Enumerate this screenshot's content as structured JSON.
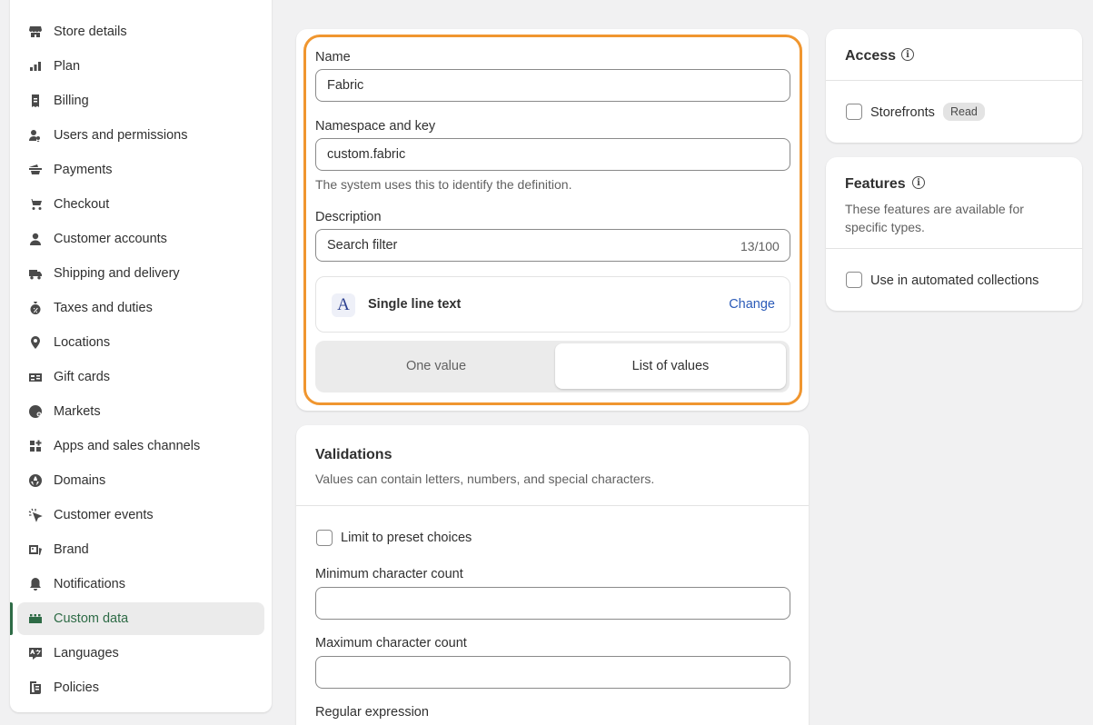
{
  "sidebar": {
    "items": [
      {
        "label": "Store details",
        "icon": "store-icon"
      },
      {
        "label": "Plan",
        "icon": "plan-icon"
      },
      {
        "label": "Billing",
        "icon": "billing-icon"
      },
      {
        "label": "Users and permissions",
        "icon": "users-icon"
      },
      {
        "label": "Payments",
        "icon": "payments-icon"
      },
      {
        "label": "Checkout",
        "icon": "cart-icon"
      },
      {
        "label": "Customer accounts",
        "icon": "person-icon"
      },
      {
        "label": "Shipping and delivery",
        "icon": "truck-icon"
      },
      {
        "label": "Taxes and duties",
        "icon": "tax-icon"
      },
      {
        "label": "Locations",
        "icon": "location-icon"
      },
      {
        "label": "Gift cards",
        "icon": "gift-card-icon"
      },
      {
        "label": "Markets",
        "icon": "globe-icon"
      },
      {
        "label": "Apps and sales channels",
        "icon": "apps-icon"
      },
      {
        "label": "Domains",
        "icon": "domain-icon"
      },
      {
        "label": "Customer events",
        "icon": "cursor-icon"
      },
      {
        "label": "Brand",
        "icon": "brand-icon"
      },
      {
        "label": "Notifications",
        "icon": "bell-icon"
      },
      {
        "label": "Custom data",
        "icon": "custom-data-icon",
        "active": true
      },
      {
        "label": "Languages",
        "icon": "language-icon"
      },
      {
        "label": "Policies",
        "icon": "policy-icon"
      }
    ]
  },
  "definition": {
    "name_label": "Name",
    "name_value": "Fabric",
    "namespace_label": "Namespace and key",
    "namespace_value": "custom.fabric",
    "namespace_help": "The system uses this to identify the definition.",
    "description_label": "Description",
    "description_value": "Search filter",
    "description_counter": "13/100",
    "type_icon_glyph": "A",
    "type_label": "Single line text",
    "change_label": "Change",
    "seg_one_value": "One value",
    "seg_list_values": "List of values",
    "selected_option": "List of values"
  },
  "validations": {
    "title": "Validations",
    "subtitle": "Values can contain letters, numbers, and special characters.",
    "preset_label": "Limit to preset choices",
    "min_label": "Minimum character count",
    "min_value": "",
    "max_label": "Maximum character count",
    "max_value": "",
    "regex_label": "Regular expression"
  },
  "access": {
    "title": "Access",
    "storefronts_label": "Storefronts",
    "storefronts_badge": "Read"
  },
  "features": {
    "title": "Features",
    "description": "These features are available for specific types.",
    "automated_label": "Use in automated collections"
  },
  "colors": {
    "accent_green": "#2e6b46",
    "focus_orange": "#f0962f",
    "link_blue": "#2b5bb8"
  }
}
